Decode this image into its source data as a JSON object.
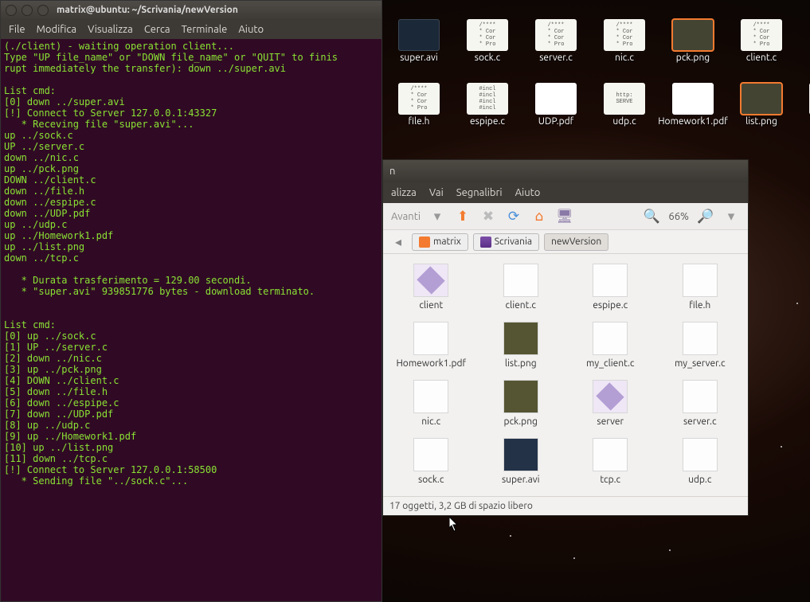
{
  "terminal": {
    "title": "matrix@ubuntu: ~/Scrivania/newVersion",
    "menu": [
      "File",
      "Modifica",
      "Visualizza",
      "Cerca",
      "Terminale",
      "Aiuto"
    ],
    "lines": [
      "(./client) - waiting operation client...",
      "Type \"UP file_name\" or \"DOWN file_name\" or \"QUIT\" to finis",
      "rupt immediately the transfer): down ../super.avi",
      "",
      "List cmd:",
      "[0] down ../super.avi",
      "[!] Connect to Server 127.0.0.1:43327",
      "   * Receving file \"super.avi\"...",
      "up ../sock.c",
      "UP ../server.c",
      "down ../nic.c",
      "up ../pck.png",
      "DOWN ../client.c",
      "down ../file.h",
      "down ../espipe.c",
      "down ../UDP.pdf",
      "up ../udp.c",
      "up ../Homework1.pdf",
      "up ../list.png",
      "down ../tcp.c",
      "",
      "   * Durata trasferimento = 129.00 secondi.",
      "   * \"super.avi\" 939851776 bytes - download terminato.",
      "",
      "",
      "List cmd:",
      "[0] up ../sock.c",
      "[1] UP ../server.c",
      "[2] down ../nic.c",
      "[3] up ../pck.png",
      "[4] DOWN ../client.c",
      "[5] down ../file.h",
      "[6] down ../espipe.c",
      "[7] down ../UDP.pdf",
      "[8] up ../udp.c",
      "[9] up ../Homework1.pdf",
      "[10] up ../list.png",
      "[11] down ../tcp.c",
      "[!] Connect to Server 127.0.0.1:58500",
      "   * Sending file \"../sock.c\"..."
    ]
  },
  "desktop": {
    "row1": [
      {
        "name": "super.avi",
        "kind": "video",
        "sel": false
      },
      {
        "name": "sock.c",
        "kind": "src",
        "sel": false
      },
      {
        "name": "server.c",
        "kind": "src",
        "sel": false
      },
      {
        "name": "nic.c",
        "kind": "src",
        "sel": false
      },
      {
        "name": "pck.png",
        "kind": "img",
        "sel": true
      },
      {
        "name": "client.c",
        "kind": "src",
        "sel": false
      }
    ],
    "row2": [
      {
        "name": "file.h",
        "kind": "src",
        "sel": false
      },
      {
        "name": "espipe.c",
        "kind": "src",
        "sel": false
      },
      {
        "name": "UDP.pdf",
        "kind": "pdf",
        "sel": false
      },
      {
        "name": "udp.c",
        "kind": "src",
        "sel": false
      },
      {
        "name": "Homework1.pdf",
        "kind": "pdf",
        "sel": false
      },
      {
        "name": "list.png",
        "kind": "img",
        "sel": true
      },
      {
        "name": "tcp.c",
        "kind": "src",
        "sel": false
      }
    ],
    "src_text": "/****\n* Cor\n* Cor\n* Pro",
    "inc_text": "#incl\n#incl\n#incl\n#incl",
    "srv_text": "http:\nSERVE"
  },
  "fm": {
    "title_suffix": "n",
    "menu": [
      "alizza",
      "Vai",
      "Segnalibri",
      "Aiuto"
    ],
    "toolbar": {
      "fwd": "Avanti",
      "zoom": "66%"
    },
    "path": [
      "matrix",
      "Scrivania",
      "newVersion"
    ],
    "files": [
      {
        "name": "client",
        "kind": "exec"
      },
      {
        "name": "client.c",
        "kind": "txt"
      },
      {
        "name": "espipe.c",
        "kind": "txt"
      },
      {
        "name": "file.h",
        "kind": "txt"
      },
      {
        "name": "Homework1.pdf",
        "kind": "pdf"
      },
      {
        "name": "list.png",
        "kind": "imgthumb"
      },
      {
        "name": "my_client.c",
        "kind": "txt"
      },
      {
        "name": "my_server.c",
        "kind": "txt"
      },
      {
        "name": "nic.c",
        "kind": "txt"
      },
      {
        "name": "pck.png",
        "kind": "imgthumb"
      },
      {
        "name": "server",
        "kind": "exec"
      },
      {
        "name": "server.c",
        "kind": "txt"
      },
      {
        "name": "sock.c",
        "kind": "txt"
      },
      {
        "name": "super.avi",
        "kind": "vid"
      },
      {
        "name": "tcp.c",
        "kind": "txt"
      },
      {
        "name": "udp.c",
        "kind": "txt"
      }
    ],
    "status": "17 oggetti, 3,2 GB di spazio libero"
  }
}
